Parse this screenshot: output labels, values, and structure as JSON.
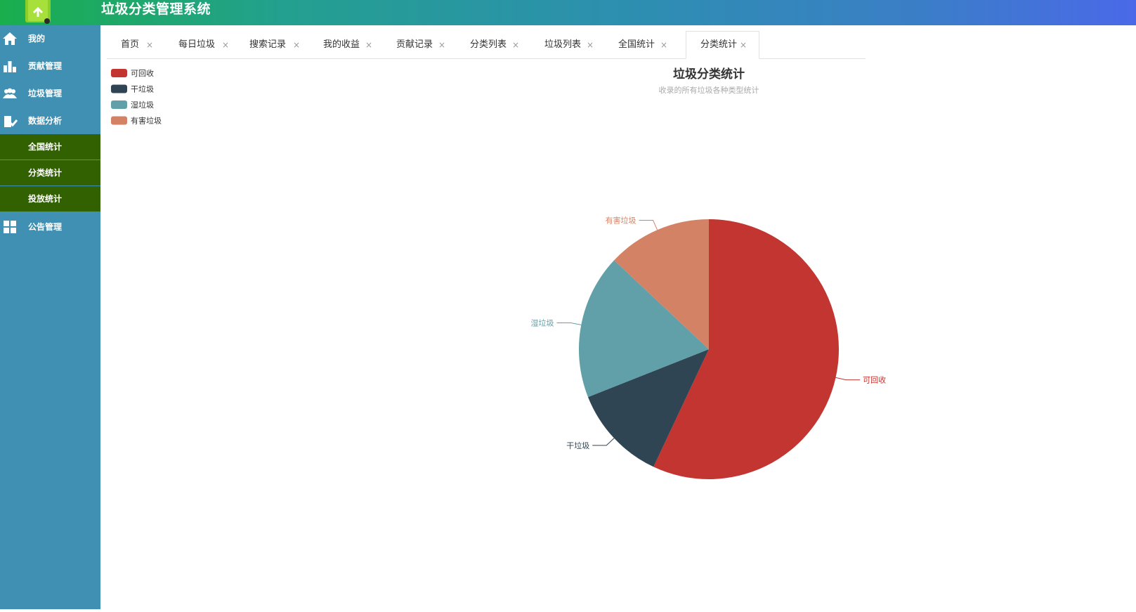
{
  "app": {
    "title": "垃圾分类管理系统",
    "logo_icon": "recycle-bin-icon"
  },
  "colors": {
    "sidebar": "#3f90b3",
    "submenu_active": "#326102",
    "header_start": "#1aae4d",
    "header_end": "#4a69e8"
  },
  "sidebar": {
    "items": [
      {
        "label": "我的",
        "icon": "home-icon"
      },
      {
        "label": "贡献管理",
        "icon": "bar-chart-icon"
      },
      {
        "label": "垃圾管理",
        "icon": "users-icon"
      },
      {
        "label": "数据分析",
        "icon": "analysis-icon"
      },
      {
        "label": "公告管理",
        "icon": "grid-icon"
      }
    ],
    "submenu": [
      {
        "label": "全国统计"
      },
      {
        "label": "分类统计"
      },
      {
        "label": "投放统计"
      }
    ]
  },
  "tabs": [
    {
      "label": "首页"
    },
    {
      "label": "每日垃圾"
    },
    {
      "label": "搜索记录"
    },
    {
      "label": "我的收益"
    },
    {
      "label": "贡献记录"
    },
    {
      "label": "分类列表"
    },
    {
      "label": "垃圾列表"
    },
    {
      "label": "全国统计"
    },
    {
      "label": "分类统计",
      "active": true
    }
  ],
  "tab_close_glyph": "×",
  "chart_data": {
    "type": "pie",
    "title": "垃圾分类统计",
    "subtitle": "收录的所有垃圾各种类型统计",
    "legend_position": "top-left",
    "series": [
      {
        "name": "可回收",
        "value": 57,
        "color": "#c23531"
      },
      {
        "name": "干垃圾",
        "value": 12,
        "color": "#2f4554"
      },
      {
        "name": "湿垃圾",
        "value": 18,
        "color": "#61a0a8"
      },
      {
        "name": "有害垃圾",
        "value": 13,
        "color": "#d48265"
      }
    ]
  }
}
